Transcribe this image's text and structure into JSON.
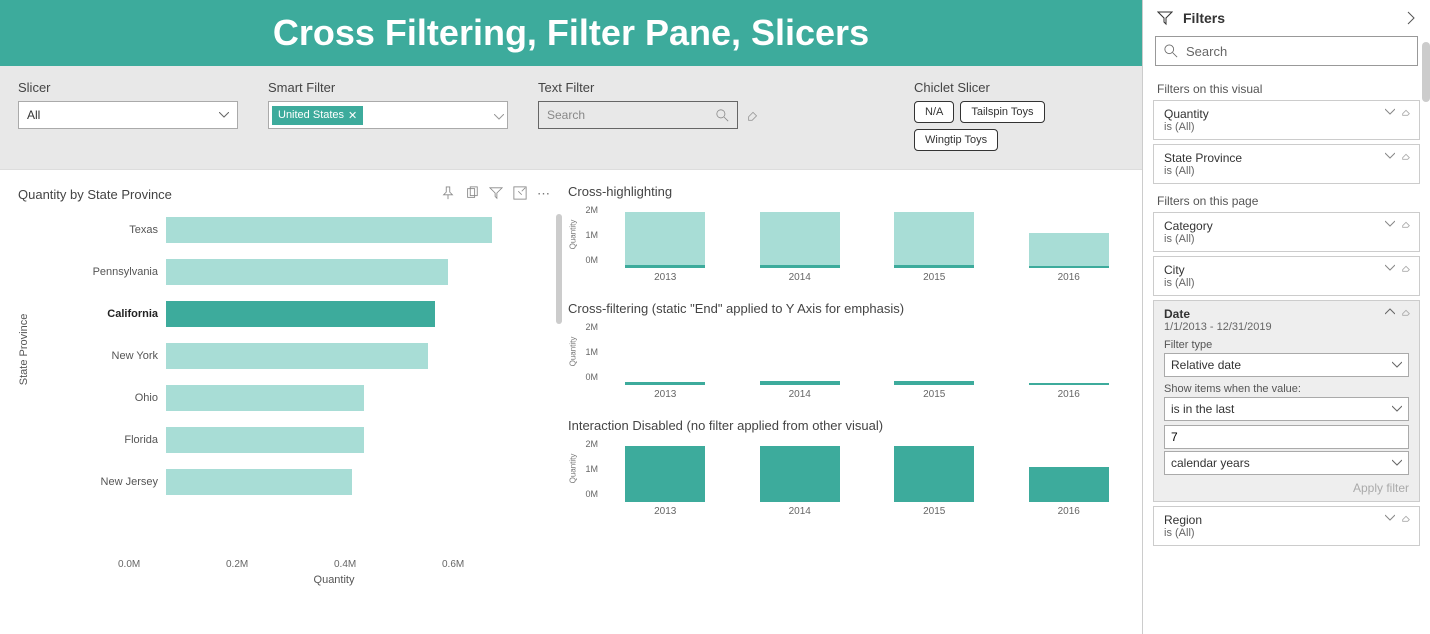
{
  "header": {
    "title": "Cross Filtering, Filter Pane, Slicers"
  },
  "controls": {
    "slicer": {
      "label": "Slicer",
      "value": "All"
    },
    "smart_filter": {
      "label": "Smart Filter",
      "tag": "United States"
    },
    "text_filter": {
      "label": "Text Filter",
      "placeholder": "Search"
    },
    "chiclet": {
      "label": "Chiclet Slicer",
      "items": [
        "N/A",
        "Tailspin Toys",
        "Wingtip Toys"
      ]
    }
  },
  "left_chart": {
    "title": "Quantity by State Province",
    "y_axis": "State Province",
    "x_axis": "Quantity",
    "ticks": [
      "0.0M",
      "0.2M",
      "0.4M",
      "0.6M"
    ]
  },
  "mini": {
    "t1": "Cross-highlighting",
    "t2": "Cross-filtering (static \"End\" applied to Y Axis for emphasis)",
    "t3": "Interaction Disabled (no filter applied from other visual)",
    "yticks": [
      "2M",
      "1M",
      "0M"
    ],
    "ylab": "Quantity"
  },
  "filters": {
    "header": "Filters",
    "search": "Search",
    "sec_visual": "Filters on this visual",
    "sec_page": "Filters on this page",
    "is_all": "is (All)",
    "cards": {
      "quantity": "Quantity",
      "state": "State Province",
      "category": "Category",
      "city": "City",
      "date": "Date",
      "date_range": "1/1/2013 - 12/31/2019",
      "filter_type_label": "Filter type",
      "filter_type_value": "Relative date",
      "show_when": "Show items when the value:",
      "rel_op": "is in the last",
      "rel_num": "7",
      "rel_unit": "calendar years",
      "apply": "Apply filter",
      "region": "Region"
    }
  },
  "chart_data": [
    {
      "type": "bar",
      "orientation": "horizontal",
      "title": "Quantity by State Province",
      "xlabel": "Quantity",
      "ylabel": "State Province",
      "xlim": [
        0,
        600000
      ],
      "categories": [
        "Texas",
        "Pennsylvania",
        "California",
        "New York",
        "Ohio",
        "Florida",
        "New Jersey"
      ],
      "values": [
        510000,
        440000,
        420000,
        410000,
        310000,
        310000,
        290000
      ],
      "highlight_index": 2
    },
    {
      "type": "bar",
      "title": "Cross-highlighting",
      "ylabel": "Quantity",
      "ylim": [
        0,
        2000000
      ],
      "categories": [
        "2013",
        "2014",
        "2015",
        "2016"
      ],
      "series": [
        {
          "name": "total",
          "values": [
            2000000,
            2200000,
            2200000,
            1250000
          ]
        },
        {
          "name": "highlighted",
          "values": [
            120000,
            130000,
            130000,
            70000
          ]
        }
      ]
    },
    {
      "type": "bar",
      "title": "Cross-filtering (static \"End\" applied to Y Axis for emphasis)",
      "ylabel": "Quantity",
      "ylim": [
        0,
        2000000
      ],
      "categories": [
        "2013",
        "2014",
        "2015",
        "2016"
      ],
      "values": [
        120000,
        130000,
        130000,
        70000
      ]
    },
    {
      "type": "bar",
      "title": "Interaction Disabled (no filter applied from other visual)",
      "ylabel": "Quantity",
      "ylim": [
        0,
        2000000
      ],
      "categories": [
        "2013",
        "2014",
        "2015",
        "2016"
      ],
      "values": [
        2000000,
        2200000,
        2200000,
        1250000
      ]
    }
  ]
}
